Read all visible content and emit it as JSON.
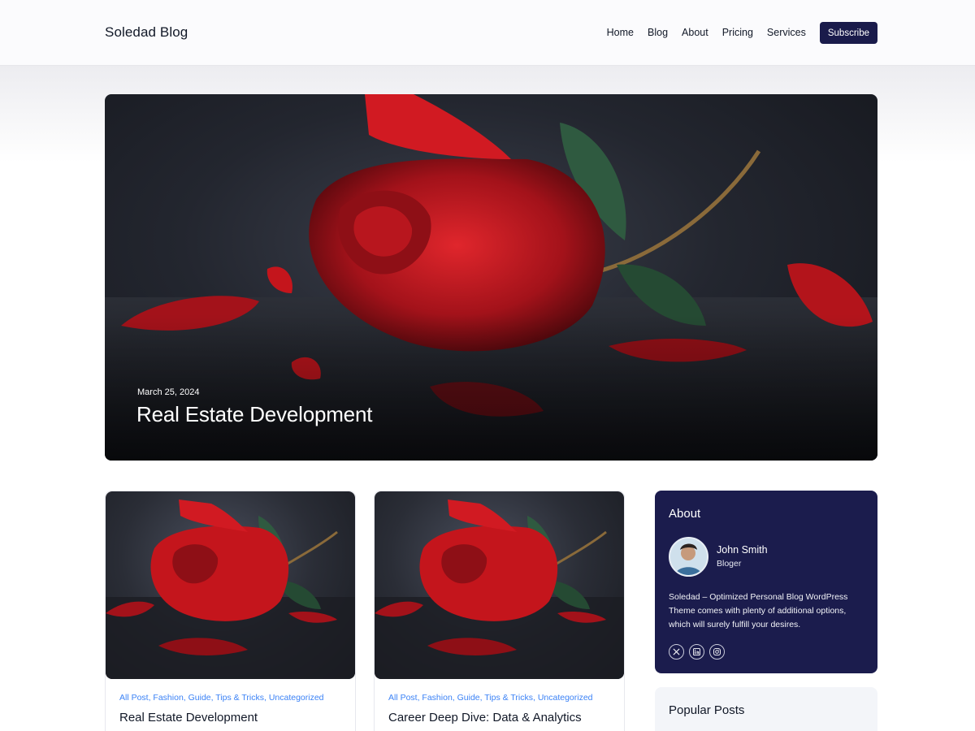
{
  "site": {
    "title": "Soledad Blog"
  },
  "nav": {
    "items": [
      {
        "label": "Home"
      },
      {
        "label": "Blog"
      },
      {
        "label": "About"
      },
      {
        "label": "Pricing"
      },
      {
        "label": "Services"
      }
    ],
    "subscribe_label": "Subscribe"
  },
  "hero": {
    "date": "March 25, 2024",
    "title": "Real Estate Development"
  },
  "posts": [
    {
      "categories": "All Post, Fashion, Guide, Tips & Tricks, Uncategorized",
      "title": "Real Estate Development"
    },
    {
      "categories": "All Post, Fashion, Guide, Tips & Tricks, Uncategorized",
      "title": "Career Deep Dive: Data & Analytics"
    }
  ],
  "sidebar": {
    "about": {
      "heading": "About",
      "author_name": "John Smith",
      "author_role": "Bloger",
      "description": "Soledad – Optimized Personal Blog WordPress Theme comes with plenty of additional options, which will surely fulfill your desires.",
      "social_icons": [
        "x-icon",
        "linkedin-icon",
        "instagram-icon"
      ]
    },
    "popular": {
      "heading": "Popular Posts"
    }
  },
  "colors": {
    "brand_navy": "#1a1b4b",
    "about_bg": "#1b1c4d",
    "category_link": "#3b82f6",
    "rose_red": "#c4151c"
  }
}
